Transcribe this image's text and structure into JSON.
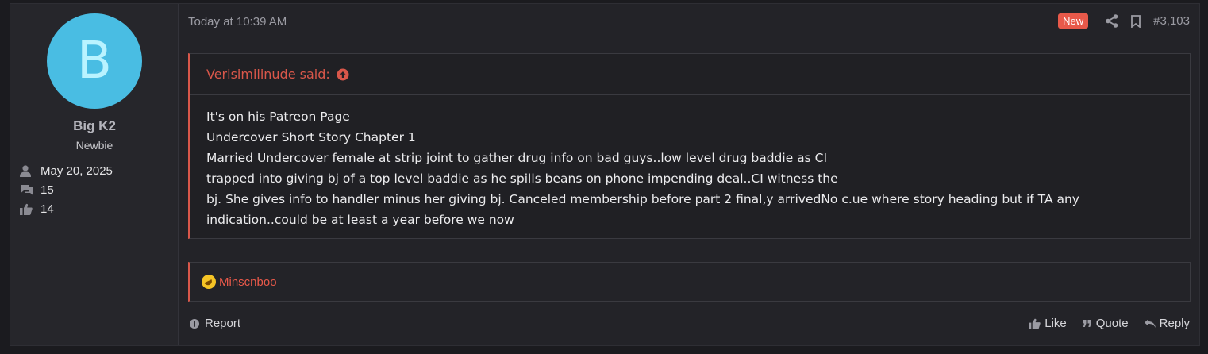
{
  "user": {
    "avatar_letter": "B",
    "avatar_color": "#49bde3",
    "name": "Big K2",
    "title": "Newbie",
    "joined": "May 20, 2025",
    "messages": "15",
    "reactions": "14"
  },
  "post": {
    "timestamp": "Today at 10:39 AM",
    "new_badge": "New",
    "number": "#3,103",
    "quote": {
      "author_line": "Verisimilinude said:",
      "lines": [
        "It's on his Patreon Page",
        "Undercover Short Story Chapter 1",
        "Married Undercover female at strip joint to gather drug info on bad guys..low level drug baddie as CI",
        "trapped into giving bj of a top level baddie as he spills beans on phone impending deal..CI witness the",
        "bj. She gives info to handler minus her giving bj. Canceled membership before part 2 final,y arrivedNo c.ue where story heading but if TA any",
        "indication..could be at least a year before we now"
      ]
    },
    "reaction_user": "Minscnboo",
    "actions": {
      "report": "Report",
      "like": "Like",
      "quote": "Quote",
      "reply": "Reply"
    }
  },
  "colors": {
    "accent": "#d9574a",
    "badge": "#e8594a",
    "background": "#232328"
  }
}
